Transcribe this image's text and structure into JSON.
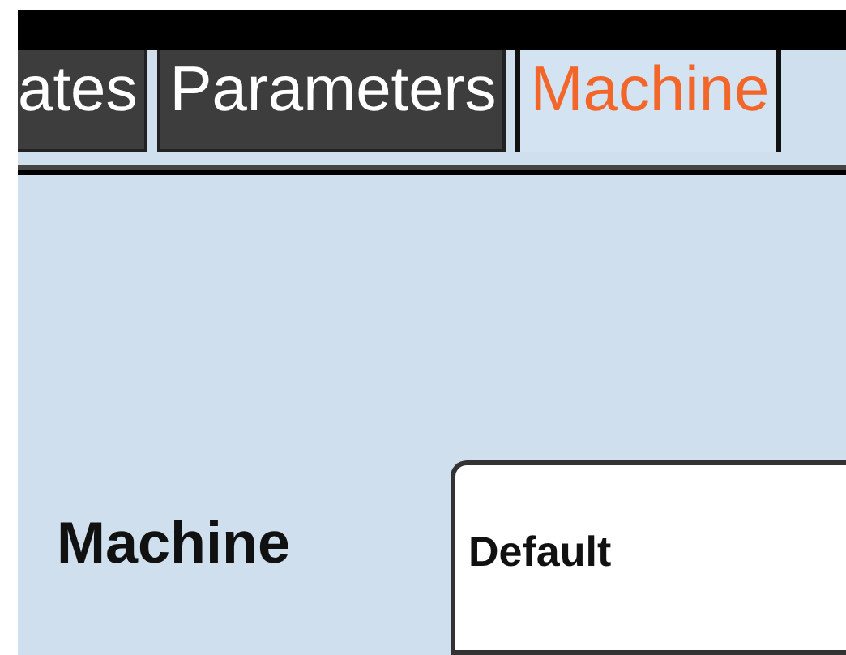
{
  "tabs": [
    {
      "label": "ates",
      "selected": false
    },
    {
      "label": "Parameters",
      "selected": false
    },
    {
      "label": "Machine",
      "selected": true
    }
  ],
  "form": {
    "label": "Machine",
    "field_value": "Default"
  }
}
